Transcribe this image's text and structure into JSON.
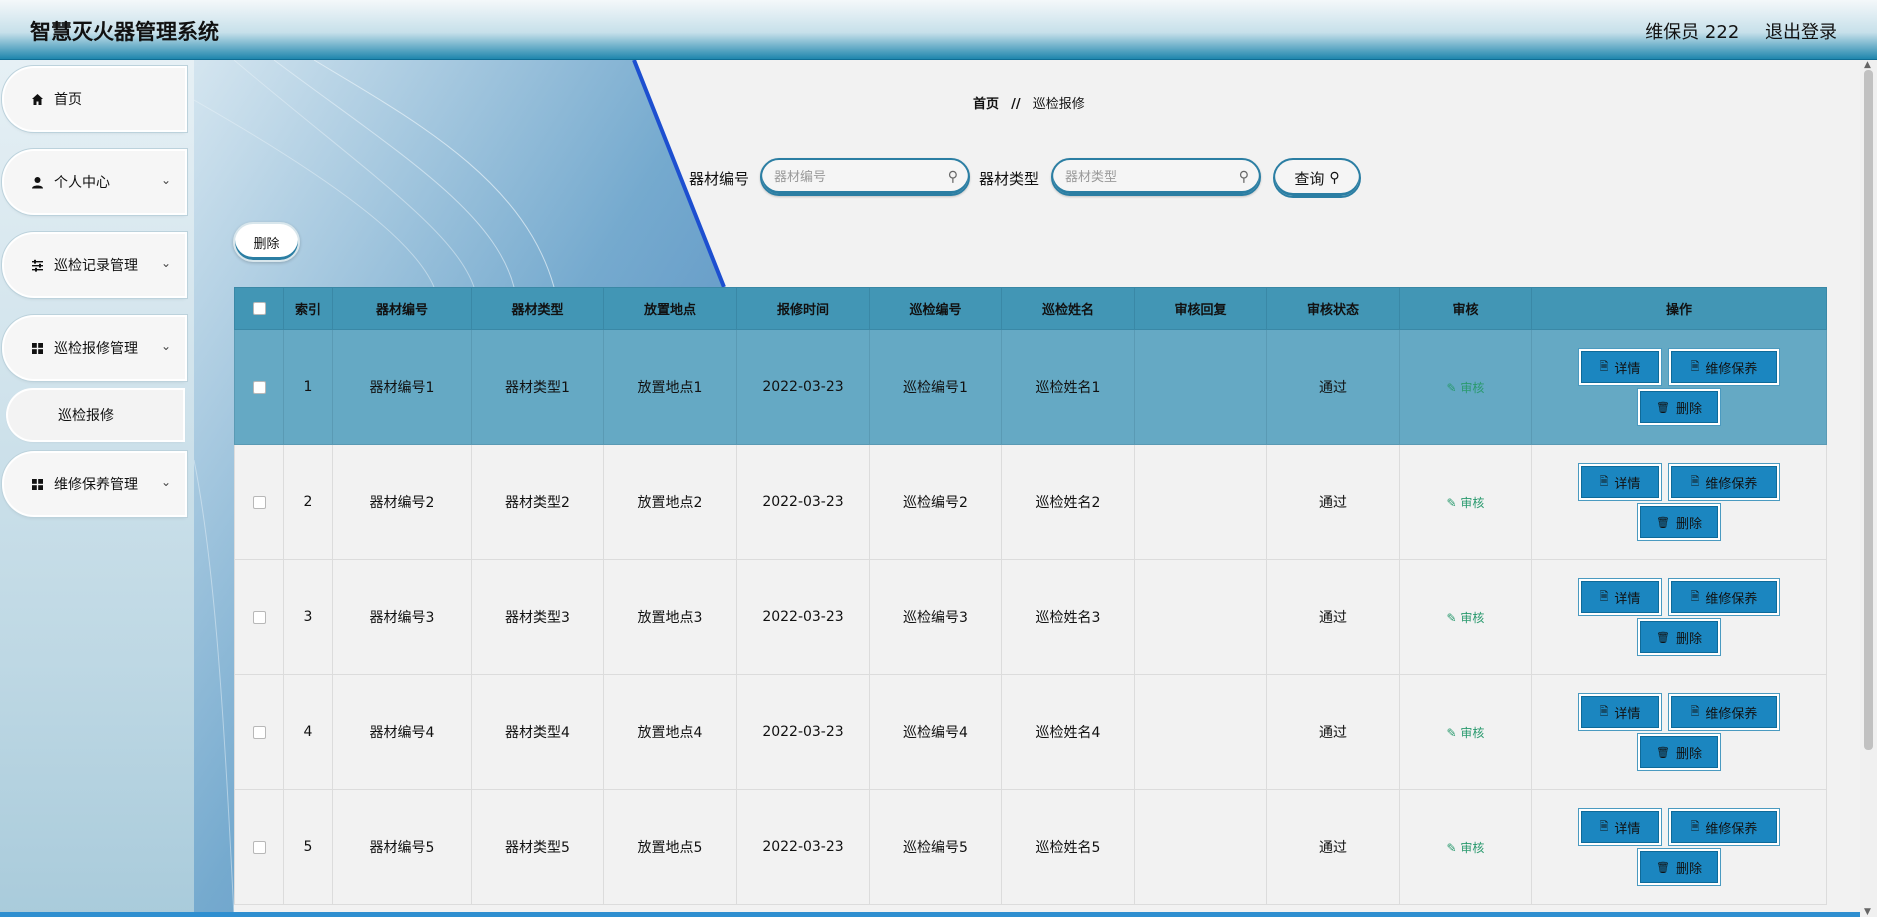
{
  "header": {
    "title": "智慧灭火器管理系统",
    "user": "维保员 222",
    "logout": "退出登录"
  },
  "sidebar": {
    "items": [
      {
        "label": "首页",
        "icon": "home-icon",
        "expandable": false
      },
      {
        "label": "个人中心",
        "icon": "user-icon",
        "expandable": true
      },
      {
        "label": "巡检记录管理",
        "icon": "sliders-icon",
        "expandable": true
      },
      {
        "label": "巡检报修管理",
        "icon": "grid-icon",
        "expandable": true
      },
      {
        "label": "维修保养管理",
        "icon": "grid-icon",
        "expandable": true
      }
    ],
    "sub_item": "巡检报修"
  },
  "breadcrumb": {
    "home": "首页",
    "separator": "//",
    "current": "巡检报修"
  },
  "search": {
    "field1_label": "器材编号",
    "field1_placeholder": "器材编号",
    "field2_label": "器材类型",
    "field2_placeholder": "器材类型",
    "query_label": "查询"
  },
  "toolbar": {
    "delete_label": "删除"
  },
  "table": {
    "headers": [
      "",
      "索引",
      "器材编号",
      "器材类型",
      "放置地点",
      "报修时间",
      "巡检编号",
      "巡检姓名",
      "审核回复",
      "审核状态",
      "审核",
      "操作"
    ],
    "rows": [
      {
        "index": "1",
        "code": "器材编号1",
        "type": "器材类型1",
        "location": "放置地点1",
        "time": "2022-03-23",
        "inspect_code": "巡检编号1",
        "inspect_name": "巡检姓名1",
        "reply": "",
        "status": "通过",
        "audit": "审核"
      },
      {
        "index": "2",
        "code": "器材编号2",
        "type": "器材类型2",
        "location": "放置地点2",
        "time": "2022-03-23",
        "inspect_code": "巡检编号2",
        "inspect_name": "巡检姓名2",
        "reply": "",
        "status": "通过",
        "audit": "审核"
      },
      {
        "index": "3",
        "code": "器材编号3",
        "type": "器材类型3",
        "location": "放置地点3",
        "time": "2022-03-23",
        "inspect_code": "巡检编号3",
        "inspect_name": "巡检姓名3",
        "reply": "",
        "status": "通过",
        "audit": "审核"
      },
      {
        "index": "4",
        "code": "器材编号4",
        "type": "器材类型4",
        "location": "放置地点4",
        "time": "2022-03-23",
        "inspect_code": "巡检编号4",
        "inspect_name": "巡检姓名4",
        "reply": "",
        "status": "通过",
        "audit": "审核"
      },
      {
        "index": "5",
        "code": "器材编号5",
        "type": "器材类型5",
        "location": "放置地点5",
        "time": "2022-03-23",
        "inspect_code": "巡检编号5",
        "inspect_name": "巡检姓名5",
        "reply": "",
        "status": "通过",
        "audit": "审核"
      }
    ],
    "actions": {
      "detail": "详情",
      "maintain": "维修保养",
      "delete": "删除"
    }
  },
  "colors": {
    "header_bottom": "#1f86ad",
    "table_header": "#4296b5",
    "row_highlight": "#65a9c4",
    "action_button": "#1b86c0"
  }
}
